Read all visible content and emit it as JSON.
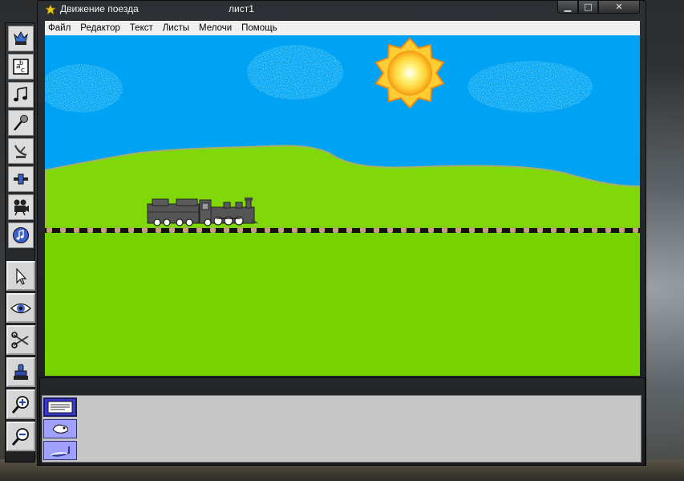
{
  "window": {
    "title": "Движение поезда",
    "sheet": "лист1",
    "controls": {
      "minimize": "▁",
      "maximize": "□",
      "close": "✕"
    }
  },
  "menu": {
    "items": [
      "Файл",
      "Редактор",
      "Текст",
      "Листы",
      "Мелочи",
      "Помощь"
    ]
  },
  "scene": {
    "sky_color": "#00a2f3",
    "grass_color": "#77d300",
    "hill_color": "#80d808",
    "sun_color": "#ffd23a",
    "track_color": "#111111",
    "sleeper_color": "#c0a17a",
    "train_color": "#555555"
  },
  "toolbar": {
    "tools": [
      "turtle-icon",
      "text-icon",
      "music-note-icon",
      "microphone-icon",
      "satellite-icon",
      "slider-icon",
      "movie-camera-icon",
      "music-disc-icon",
      "pointer-icon",
      "eye-icon",
      "scissors-icon",
      "stamp-icon",
      "zoom-in-icon",
      "zoom-out-icon"
    ],
    "active_tool": "pointer-icon"
  },
  "pages_panel": {
    "thumbnails": [
      "page-text-icon",
      "page-shape-icon",
      "page-wave-icon"
    ],
    "active_index": 0
  }
}
